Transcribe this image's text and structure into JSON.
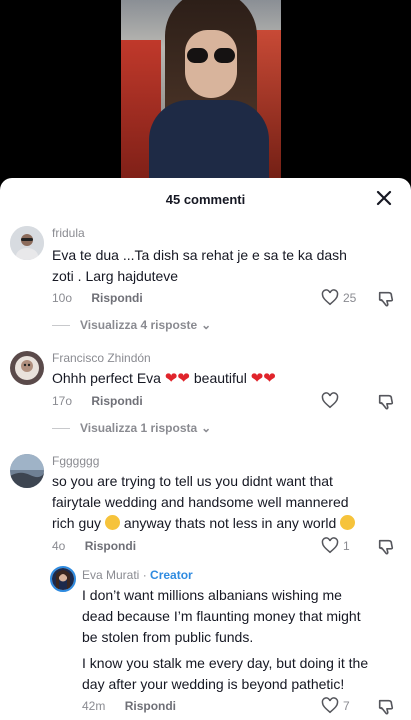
{
  "sheet": {
    "title": "45 commenti"
  },
  "comments": [
    {
      "username": "fridula",
      "text_line1": "Eva te dua ...Ta dish sa rehat je e sa te ka dash",
      "text_line2": "zoti . Larg hajduteve",
      "time": "10o",
      "reply_label": "Rispondi",
      "likes": "25",
      "view_replies": "Visualizza 4 risposte"
    },
    {
      "username": "Francisco Zhindón",
      "text_start": "Ohhh perfect Eva",
      "text_mid": "beautiful",
      "time": "17o",
      "reply_label": "Rispondi",
      "likes": "",
      "view_replies": "Visualizza 1 risposta"
    },
    {
      "username": "Fgggggg",
      "text_line1": "so you are trying to tell us you didnt want that",
      "text_line2": "fairytale wedding and handsome well mannered",
      "text_line3_a": "rich guy",
      "text_line3_b": "anyway thats not less in any world",
      "time": "4o",
      "reply_label": "Rispondi",
      "likes": "1"
    },
    {
      "username": "Eva Murati",
      "badge": "Creator",
      "text_line1": "I don’t want millions albanians wishing me",
      "text_line2": "dead because I’m flaunting money that might",
      "text_line3": "be stolen from public funds.",
      "text_line4": "I know you stalk me every day, but doing it the",
      "text_line5": "day after your wedding is beyond pathetic!",
      "time": "42m",
      "reply_label": "Rispondi",
      "likes": "7"
    }
  ]
}
